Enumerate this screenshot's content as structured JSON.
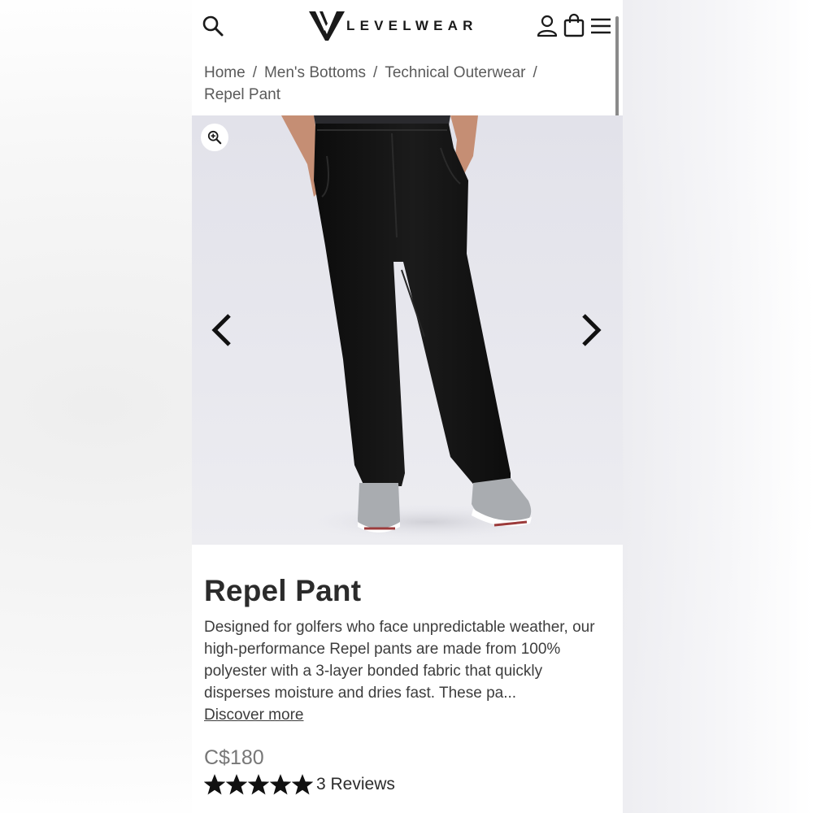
{
  "header": {
    "brand": "LEVELWEAR",
    "icons": [
      "search-icon",
      "account-icon",
      "shopping-bag-icon",
      "menu-icon"
    ]
  },
  "breadcrumb": {
    "items": [
      "Home",
      "Men's Bottoms",
      "Technical Outerwear",
      "Repel Pant"
    ],
    "separator": "/"
  },
  "gallery": {
    "zoom_icon": "zoom-in-icon",
    "prev_icon": "chevron-left-icon",
    "next_icon": "chevron-right-icon"
  },
  "product": {
    "title": "Repel Pant",
    "description": "Designed for golfers who face unpredictable weather, our high-performance Repel pants are made from 100% polyester with a 3-layer bonded fabric that quickly disperses moisture and dries fast. These pa...",
    "discover_label": "Discover more",
    "price": "C$180",
    "rating": 5,
    "rating_max": 5,
    "reviews_label": "3 Reviews"
  },
  "colors": {
    "text_dark": "#2b2b2b",
    "text_muted": "#5a5a5a",
    "price": "#777777",
    "pant": "#141414",
    "shoe": "#a9acb0"
  }
}
